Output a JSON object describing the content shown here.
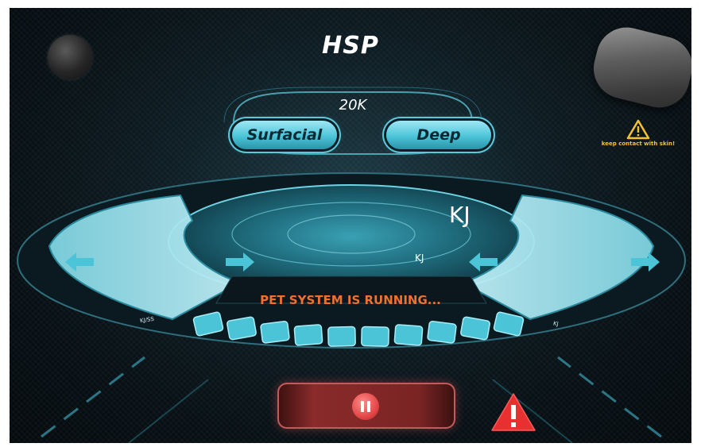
{
  "app": {
    "title": "HSP"
  },
  "frequency": {
    "label": "20K"
  },
  "modes": [
    {
      "label": "Surfacial"
    },
    {
      "label": "Deep"
    }
  ],
  "warning": {
    "text": "keep contact with skin!"
  },
  "energy": {
    "big_unit": "KJ",
    "small_unit": "KJ"
  },
  "status": {
    "text": "PET SYSTEM IS RUNNING..."
  },
  "scale": {
    "left_label": "KJ/SS",
    "right_label": "KJ"
  },
  "level": {
    "segments_total": 10
  },
  "controls": {
    "pause": "pause-icon",
    "alarm": "alarm-warning-icon",
    "arrows": [
      "left-arrow-icon",
      "left-arrow-icon",
      "right-arrow-icon",
      "right-arrow-icon"
    ]
  },
  "colors": {
    "accent": "#4cc4d8",
    "status": "#f0702e",
    "danger": "#e83030",
    "warning": "#f2c230",
    "background": "#0a161c"
  }
}
